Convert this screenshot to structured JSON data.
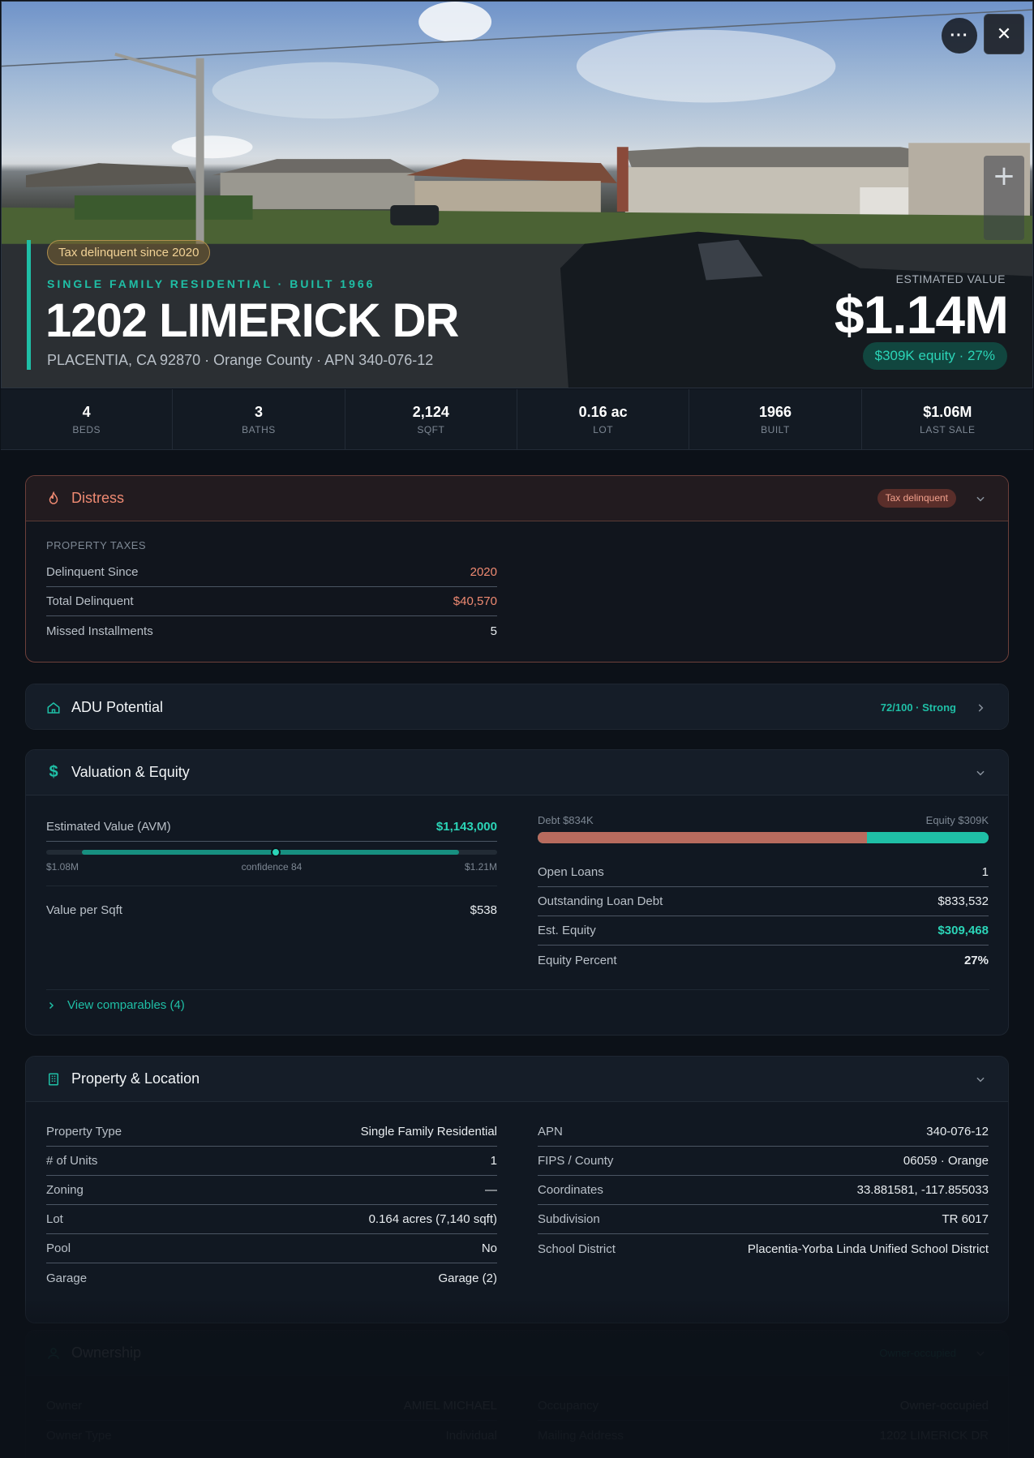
{
  "hero": {
    "tax_pill": "Tax delinquent since 2020",
    "subtype": "SINGLE FAMILY RESIDENTIAL · BUILT 1966",
    "address": "1202 LIMERICK DR",
    "subaddress": "PLACENTIA, CA 92870 · Orange County · APN 340-076-12",
    "estimated_label": "ESTIMATED VALUE",
    "estimated_value": "$1.14M",
    "equity_pill": "$309K equity · 27%",
    "more_label": "···",
    "close_label": "✕",
    "zoom_label": "+"
  },
  "stats": [
    {
      "value": "4",
      "label": "BEDS"
    },
    {
      "value": "3",
      "label": "BATHS"
    },
    {
      "value": "2,124",
      "label": "SQFT"
    },
    {
      "value": "0.16 ac",
      "label": "LOT"
    },
    {
      "value": "1966",
      "label": "BUILT"
    },
    {
      "value": "$1.06M",
      "label": "LAST SALE"
    }
  ],
  "distress": {
    "title": "Distress",
    "badge": "Tax delinquent",
    "section": "PROPERTY TAXES",
    "rows": [
      {
        "k": "Delinquent Since",
        "v": "2020"
      },
      {
        "k": "Total Delinquent",
        "v": "$40,570"
      },
      {
        "k": "Missed Installments",
        "v": "5"
      }
    ]
  },
  "adu": {
    "title": "ADU Potential",
    "score": "72/100 · Strong"
  },
  "valuation": {
    "title": "Valuation & Equity",
    "avm_label": "Estimated Value (AVM)",
    "avm_value": "$1,143,000",
    "range_low": "$1.08M",
    "confidence": "confidence 84",
    "range_high": "$1.21M",
    "confidence_position": 0.5,
    "value_per_sqft_label": "Value per Sqft",
    "value_per_sqft": "$538",
    "debt_label": "Debt $834K",
    "equity_label": "Equity $309K",
    "debt_fraction": 0.73,
    "rows": [
      {
        "k": "Open Loans",
        "v": "1"
      },
      {
        "k": "Outstanding Loan Debt",
        "v": "$833,532"
      },
      {
        "k": "Est. Equity",
        "v": "$309,468"
      },
      {
        "k": "Equity Percent",
        "v": "27%"
      }
    ],
    "comparables": "View comparables (4)"
  },
  "property": {
    "title": "Property & Location",
    "left": [
      {
        "k": "Property Type",
        "v": "Single Family Residential"
      },
      {
        "k": "# of Units",
        "v": "1"
      },
      {
        "k": "Zoning",
        "v": "—"
      },
      {
        "k": "Lot",
        "v": "0.164 acres (7,140 sqft)"
      },
      {
        "k": "Pool",
        "v": "No"
      },
      {
        "k": "Garage",
        "v": "Garage (2)"
      }
    ],
    "right": [
      {
        "k": "APN",
        "v": "340-076-12"
      },
      {
        "k": "FIPS / County",
        "v": "06059 · Orange"
      },
      {
        "k": "Coordinates",
        "v": "33.881581, -117.855033"
      },
      {
        "k": "Subdivision",
        "v": "TR 6017"
      },
      {
        "k": "School District",
        "v": "Placentia-Yorba Linda Unified School District"
      }
    ]
  },
  "ownership": {
    "title": "Ownership",
    "badge": "Owner-occupied",
    "left": [
      {
        "k": "Owner",
        "v": "AMIEL MICHAEL"
      },
      {
        "k": "Owner Type",
        "v": "Individual"
      }
    ],
    "right": [
      {
        "k": "Occupancy",
        "v": "Owner-occupied"
      },
      {
        "k": "Mailing Address",
        "v": "1202 LIMERICK DR"
      }
    ]
  },
  "colors": {
    "accent": "#1fbfa6",
    "distress": "#ef8a72",
    "debt": "#b86b5e"
  }
}
